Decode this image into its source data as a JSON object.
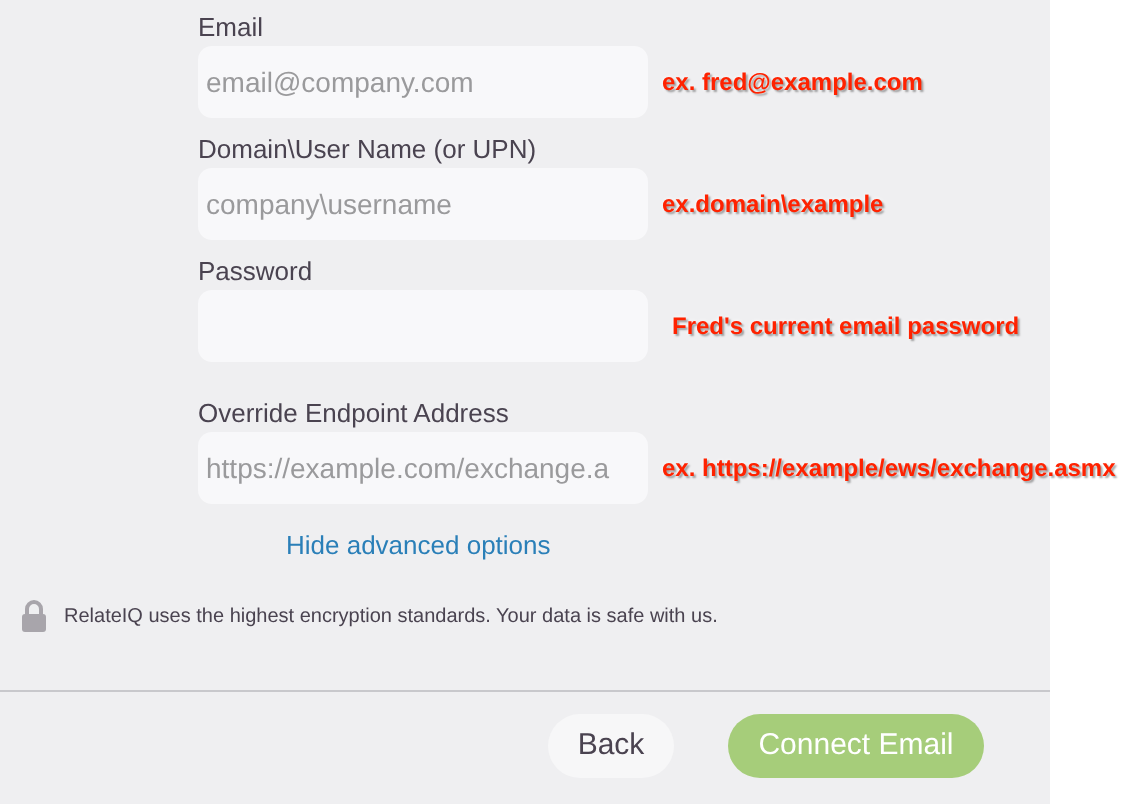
{
  "fields": [
    {
      "label": "Email",
      "placeholder": "email@company.com",
      "annotation": "ex. fred@example.com"
    },
    {
      "label": "Domain\\User Name (or UPN)",
      "placeholder": "company\\username",
      "annotation": "ex.domain\\example"
    },
    {
      "label": "Password",
      "annotation": "Fred's current email password"
    },
    {
      "label": "Override Endpoint Address",
      "placeholder": "https://example.com/exchange.a",
      "annotation": "ex. https://example/ews/exchange.asmx"
    }
  ],
  "advanced_link": "Hide advanced options",
  "security_note": "RelateIQ uses the highest encryption standards. Your data is safe with us.",
  "buttons": [
    {
      "label": "Back",
      "kind": "secondary"
    },
    {
      "label": "Connect Email",
      "kind": "primary"
    }
  ]
}
